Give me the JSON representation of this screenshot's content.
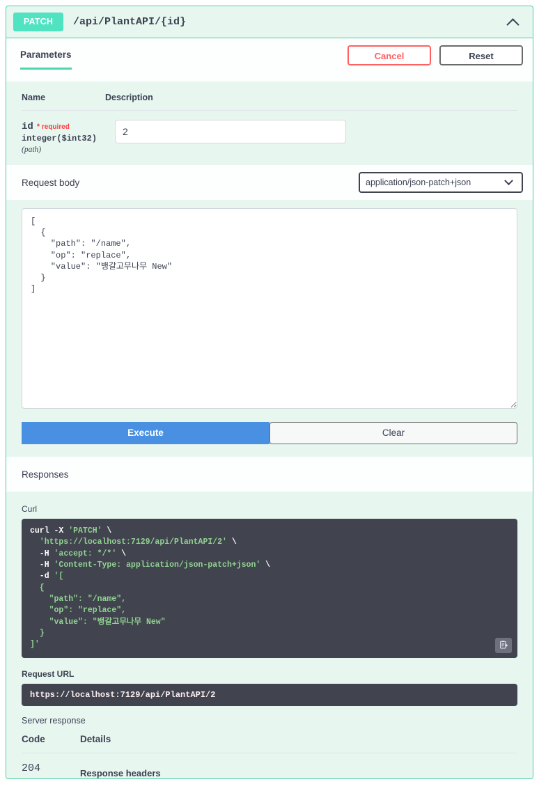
{
  "operation": {
    "method": "PATCH",
    "path": "/api/PlantAPI/{id}",
    "collapse_icon": "chevron-up-icon"
  },
  "tabs": {
    "parameters_label": "Parameters",
    "cancel_label": "Cancel",
    "reset_label": "Reset"
  },
  "parameters": {
    "col_name": "Name",
    "col_description": "Description",
    "rows": [
      {
        "name": "id",
        "required_star": "*",
        "required_label": "required",
        "type": "integer($int32)",
        "in": "(path)",
        "value": "2",
        "placeholder": "id"
      }
    ]
  },
  "request_body": {
    "title": "Request body",
    "media_type": "application/json-patch+json",
    "caret_icon": "chevron-down-icon",
    "value": "[\n  {\n    \"path\": \"/name\",\n    \"op\": \"replace\",\n    \"value\": \"뱅갈고무나무 New\"\n  }\n]"
  },
  "actions": {
    "execute_label": "Execute",
    "clear_label": "Clear"
  },
  "responses": {
    "title": "Responses",
    "curl_label": "Curl",
    "curl_line1_cmd": "curl -X ",
    "curl_line1_val": "'PATCH'",
    "curl_line1_end": " \\",
    "curl_url": "  'https://localhost:7129/api/PlantAPI/2'",
    "curl_accept_flag": "  -H ",
    "curl_accept_val": "'accept: */*'",
    "curl_ct_flag": "  -H ",
    "curl_ct_val": "'Content-Type: application/json-patch+json'",
    "curl_d_flag": "  -d ",
    "curl_d_val": "'[",
    "curl_body": "  {\n    \"path\": \"/name\",\n    \"op\": \"replace\",\n    \"value\": \"뱅갈고무나무 New\"\n  }\n]'",
    "copy_icon": "copy-to-clipboard-icon",
    "request_url_label": "Request URL",
    "request_url": "https://localhost:7129/api/PlantAPI/2",
    "server_response_label": "Server response",
    "col_code": "Code",
    "col_details": "Details",
    "rows": [
      {
        "code": "204",
        "detail_title": "Response headers"
      }
    ]
  },
  "colors": {
    "method_badge": "#50e3c2",
    "block_border": "#49cea1",
    "block_bg": "#e8f6f0",
    "tab_underline": "#4dd5ae",
    "cancel_red": "#ff6060",
    "execute_blue": "#4990e2",
    "code_bg": "#41444e",
    "code_green": "#92d292",
    "required_red": "#f93e3e"
  }
}
